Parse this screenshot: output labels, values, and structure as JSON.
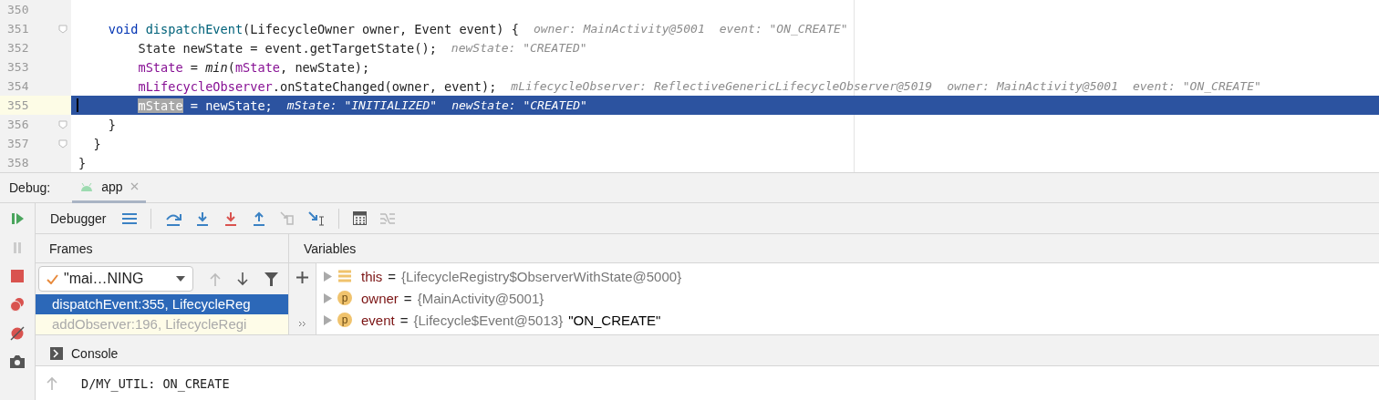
{
  "editor": {
    "lines": [
      {
        "number": "350",
        "selected": false,
        "fold": false
      },
      {
        "number": "351",
        "selected": false,
        "fold": true,
        "tokens": [
          {
            "kind": "keyword",
            "text": "    void "
          },
          {
            "kind": "declaration",
            "text": "dispatchEvent"
          },
          {
            "kind": "plain",
            "text": "(LifecycleOwner owner, Event event) {"
          },
          {
            "kind": "hint",
            "text": "owner: MainActivity@5001"
          },
          {
            "kind": "hint",
            "text": "event: \"ON_CREATE\""
          }
        ]
      },
      {
        "number": "352",
        "selected": false,
        "fold": false,
        "tokens": [
          {
            "kind": "plain",
            "text": "        State newState = event.getTargetState();"
          },
          {
            "kind": "hint",
            "text": "newState: \"CREATED\""
          }
        ]
      },
      {
        "number": "353",
        "selected": false,
        "fold": false,
        "tokens": [
          {
            "kind": "field",
            "text": "        mState"
          },
          {
            "kind": "plain",
            "text": " = "
          },
          {
            "kind": "static",
            "text": "min"
          },
          {
            "kind": "plain",
            "text": "("
          },
          {
            "kind": "field",
            "text": "mState"
          },
          {
            "kind": "plain",
            "text": ", newState);"
          }
        ]
      },
      {
        "number": "354",
        "selected": false,
        "fold": false,
        "tokens": [
          {
            "kind": "field",
            "text": "        mLifecycleObserver"
          },
          {
            "kind": "plain",
            "text": ".onStateChanged(owner, event);"
          },
          {
            "kind": "hint",
            "text": "mLifecycleObserver: ReflectiveGenericLifecycleObserver@5019"
          },
          {
            "kind": "hint",
            "text": "owner: MainActivity@5001"
          },
          {
            "kind": "hint",
            "text": "event: \"ON_CREATE\""
          }
        ]
      },
      {
        "number": "355",
        "selected": true,
        "fold": false,
        "tokens": [
          {
            "kind": "usage",
            "text": "        mState"
          },
          {
            "kind": "plain",
            "text": " = newState;"
          },
          {
            "kind": "hint",
            "text": "mState: \"INITIALIZED\""
          },
          {
            "kind": "hint",
            "text": "newState: \"CREATED\""
          }
        ]
      },
      {
        "number": "356",
        "selected": false,
        "fold": true,
        "tokens": [
          {
            "kind": "plain",
            "text": "    }"
          }
        ]
      },
      {
        "number": "357",
        "selected": false,
        "fold": true,
        "tokens": [
          {
            "kind": "plain",
            "text": "  }"
          }
        ]
      },
      {
        "number": "358",
        "selected": false,
        "fold": false,
        "tokens": [
          {
            "kind": "plain",
            "text": "}"
          }
        ]
      }
    ]
  },
  "debug": {
    "label": "Debug:",
    "tabs": [
      {
        "label": "app",
        "selected": true
      }
    ]
  },
  "toolbar": {
    "title": "Debugger"
  },
  "frames": {
    "title": "Frames",
    "thread": "\"mai…NING",
    "items": [
      {
        "label": "dispatchEvent:355, LifecycleReg",
        "selected": true
      },
      {
        "label": "addObserver:196, LifecycleRegi",
        "selected": false
      }
    ]
  },
  "variables": {
    "title": "Variables",
    "items": [
      {
        "kind": "field",
        "name": "this",
        "operator": "=",
        "value": "{LifecycleRegistry$ObserverWithState@5000}"
      },
      {
        "kind": "param",
        "icon_letter": "p",
        "name": "owner",
        "operator": "=",
        "value": "{MainActivity@5001}"
      },
      {
        "kind": "param",
        "icon_letter": "p",
        "name": "event",
        "operator": "=",
        "value": "{Lifecycle$Event@5013}",
        "string": "\"ON_CREATE\""
      }
    ]
  },
  "console": {
    "title": "Console",
    "output": "D/MY_UTIL: ON_CREATE"
  }
}
